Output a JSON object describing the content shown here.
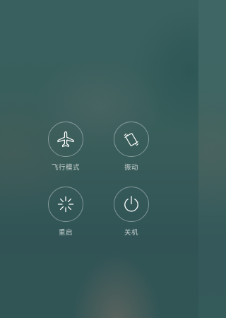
{
  "power_menu": {
    "buttons": [
      {
        "label": "飞行模式",
        "icon": "airplane-icon"
      },
      {
        "label": "振动",
        "icon": "vibrate-icon"
      },
      {
        "label": "重启",
        "icon": "reboot-icon"
      },
      {
        "label": "关机",
        "icon": "power-icon"
      }
    ]
  },
  "colors": {
    "background": "#3d6261",
    "icon_stroke": "#ffffff",
    "label_text": "#ffffffb8"
  }
}
